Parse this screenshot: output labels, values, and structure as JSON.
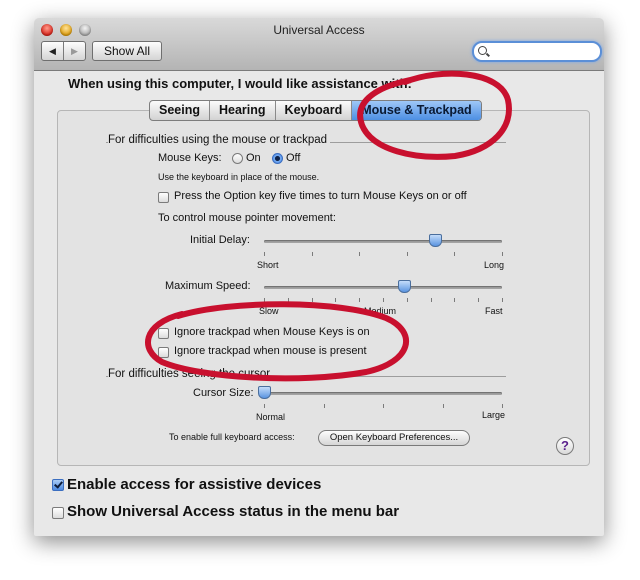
{
  "window": {
    "title": "Universal Access"
  },
  "toolbar": {
    "back_glyph": "◀",
    "forward_glyph": "▶",
    "show_all_label": "Show All",
    "search_value": "",
    "search_placeholder": ""
  },
  "main": {
    "heading": "When using this computer, I would like assistance with:",
    "tabs": [
      {
        "label": "Seeing",
        "active": false
      },
      {
        "label": "Hearing",
        "active": false
      },
      {
        "label": "Keyboard",
        "active": false
      },
      {
        "label": "Mouse & Trackpad",
        "active": true
      }
    ]
  },
  "mouse_section": {
    "title": "For difficulties using the mouse or trackpad",
    "mouse_keys_label": "Mouse Keys:",
    "on_label": "On",
    "off_label": "Off",
    "selected": "Off",
    "hint": "Use the keyboard in place of the mouse.",
    "option_key_label": "Press the Option key five times to turn Mouse Keys on or off",
    "option_key_checked": false,
    "pointer_control_label": "To control mouse pointer movement:",
    "initial_delay": {
      "label": "Initial Delay:",
      "min_label": "Short",
      "max_label": "Long",
      "value": 0.72
    },
    "maximum_speed": {
      "label": "Maximum Speed:",
      "min_label": "Slow",
      "mid_label": "Medium",
      "max_label": "Fast",
      "value": 0.59
    },
    "ignore_trackpad_mouse_keys": {
      "label": "Ignore trackpad when Mouse Keys is on",
      "checked": false
    },
    "ignore_trackpad_mouse_present": {
      "label": "Ignore trackpad when mouse is present",
      "checked": false
    }
  },
  "cursor_section": {
    "title": "For difficulties seeing the cursor",
    "cursor_size": {
      "label": "Cursor Size:",
      "min_label": "Normal",
      "max_label": "Large",
      "value": 0.0
    }
  },
  "keyboard_access": {
    "label": "To enable full keyboard access:",
    "button_label": "Open Keyboard Preferences..."
  },
  "help_glyph": "?",
  "footer": {
    "assistive_devices": {
      "label": "Enable access for assistive devices",
      "checked": true
    },
    "status_menu": {
      "label": "Show Universal Access status in the menu bar",
      "checked": false
    }
  },
  "colors": {
    "accent": "#4d8fe3",
    "annotation": "#c8102e"
  },
  "icons": {
    "back": "back-arrow-icon",
    "forward": "forward-arrow-icon",
    "search": "search-icon",
    "help": "help-icon"
  }
}
